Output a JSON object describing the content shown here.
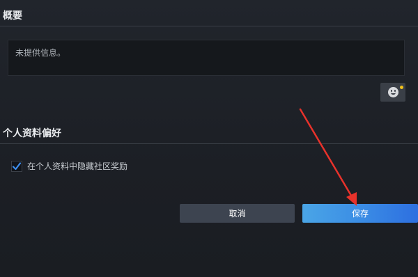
{
  "summary": {
    "title": "概要",
    "placeholder_text": "未提供信息。"
  },
  "preferences": {
    "title": "个人资料偏好",
    "hide_rewards_label": "在个人资料中隐藏社区奖励",
    "hide_rewards_checked": true
  },
  "buttons": {
    "cancel_label": "取消",
    "save_label": "保存"
  },
  "icons": {
    "emoji": "smiley-icon",
    "checkmark": "checkmark-icon"
  },
  "colors": {
    "save_button": "#3b8de5",
    "cancel_button": "#3d4450",
    "annotation_arrow": "#e8322b",
    "notification_dot": "#f2c21b"
  }
}
